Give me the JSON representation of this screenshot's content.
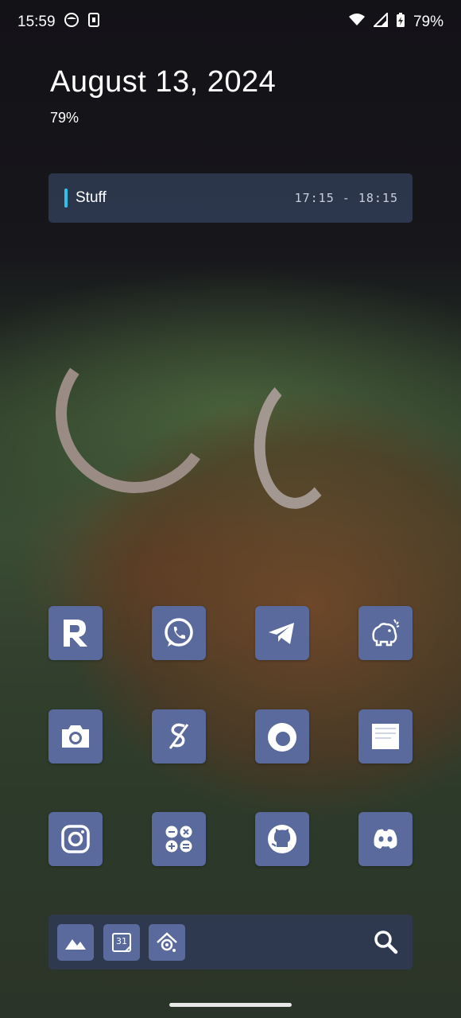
{
  "status_bar": {
    "time": "15:59",
    "battery_percent": "79%",
    "left_icons": [
      "ghost-icon",
      "sim-card-icon"
    ],
    "right_icons": [
      "wifi-icon",
      "signal-icon",
      "battery-charging-icon"
    ]
  },
  "widget": {
    "date": "August 13, 2024",
    "battery": "79%"
  },
  "event": {
    "title": "Stuff",
    "time": "17:15 - 18:15",
    "accent_color": "#29c4e8"
  },
  "apps": [
    {
      "name": "relay-icon",
      "label": ""
    },
    {
      "name": "whatsapp-icon",
      "label": ""
    },
    {
      "name": "telegram-icon",
      "label": ""
    },
    {
      "name": "elephant-icon",
      "label": ""
    },
    {
      "name": "camera-icon",
      "label": ""
    },
    {
      "name": "splitwise-icon",
      "label": ""
    },
    {
      "name": "firefox-icon",
      "label": ""
    },
    {
      "name": "notes-icon",
      "label": ""
    },
    {
      "name": "instagram-icon",
      "label": ""
    },
    {
      "name": "calculator-icon",
      "label": ""
    },
    {
      "name": "github-icon",
      "label": ""
    },
    {
      "name": "discord-icon",
      "label": ""
    }
  ],
  "dock": {
    "apps": [
      "gallery-icon",
      "calendar-icon",
      "home-assistant-icon"
    ],
    "calendar_day": "31",
    "search_icon": "search-icon"
  },
  "colors": {
    "icon_bg": "#5a6a9c",
    "widget_bg": "#2e3950"
  }
}
